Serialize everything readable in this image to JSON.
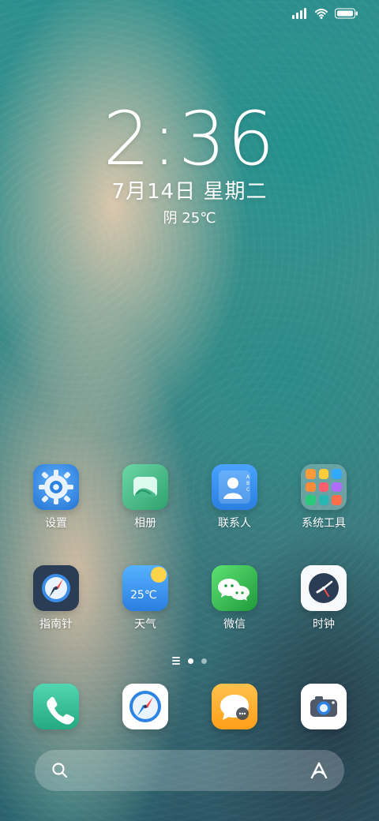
{
  "lockscreen": {
    "time": "2:36",
    "date": "7月14日 星期二",
    "weather": "阴 25℃"
  },
  "apps": [
    {
      "id": "settings",
      "label": "设置",
      "icon": "gear-icon"
    },
    {
      "id": "gallery",
      "label": "相册",
      "icon": "gallery-icon"
    },
    {
      "id": "contacts",
      "label": "联系人",
      "icon": "contacts-icon"
    },
    {
      "id": "system_tools",
      "label": "系统工具",
      "icon": "folder-grid-icon"
    },
    {
      "id": "compass",
      "label": "指南针",
      "icon": "compass-icon"
    },
    {
      "id": "weather",
      "label": "天气",
      "icon": "weather-icon",
      "tile_text": "25℃"
    },
    {
      "id": "wechat",
      "label": "微信",
      "icon": "wechat-icon"
    },
    {
      "id": "clock",
      "label": "时钟",
      "icon": "clock-icon"
    }
  ],
  "dock": [
    {
      "id": "phone",
      "icon": "phone-icon"
    },
    {
      "id": "browser",
      "icon": "browser-compass-icon"
    },
    {
      "id": "messages",
      "icon": "message-bubble-icon"
    },
    {
      "id": "camera",
      "icon": "camera-icon"
    }
  ],
  "pager": {
    "pages": 2,
    "current": 1
  },
  "colors": {
    "settings": "#3b8de6",
    "gallery": "#49b88a",
    "contacts": "#2d84e4",
    "compass": "#2b3d55",
    "weather": "#2b87e6",
    "wechat": "#2aa745",
    "clock": "#f7f9fb",
    "phone": "#2dbb97",
    "browser": "#ffffff",
    "messages": "#ffb233",
    "camera": "#ffffff"
  }
}
